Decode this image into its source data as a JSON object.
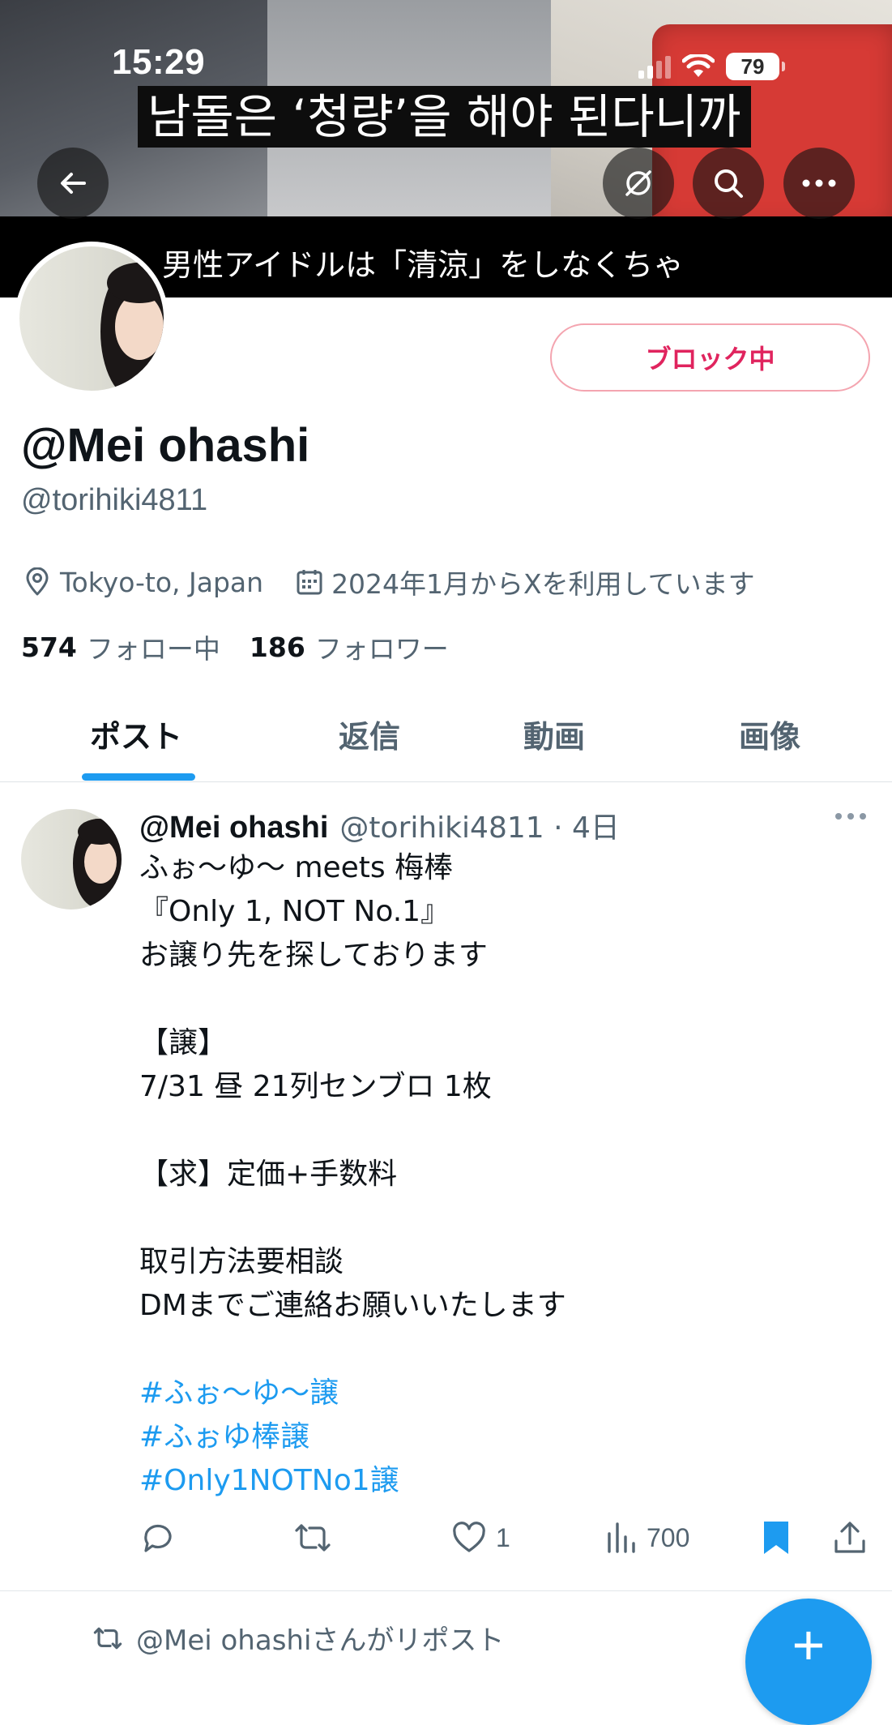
{
  "status_bar": {
    "time": "15:29",
    "battery": "79"
  },
  "banner": {
    "subtitle_korean": "남돌은 ‘청량’을 해야 된다니까",
    "subtitle_japanese": "男性アイドルは「清涼」をしなくちゃ"
  },
  "profile": {
    "block_button_label": "ブロック中",
    "display_name": "@Mei ohashi",
    "handle": "@torihiki4811",
    "location": "Tokyo-to, Japan",
    "joined": "2024年1月からXを利用しています",
    "following_count": "574",
    "following_label": "フォロー中",
    "followers_count": "186",
    "followers_label": "フォロワー"
  },
  "tabs": [
    {
      "label": "ポスト",
      "active": true
    },
    {
      "label": "返信",
      "active": false
    },
    {
      "label": "動画",
      "active": false
    },
    {
      "label": "画像",
      "active": false
    }
  ],
  "post": {
    "author_name": "@Mei ohashi",
    "author_handle": "@torihiki4811",
    "time": "4日",
    "lines": [
      "ふぉ〜ゆ〜 meets 梅棒",
      "『Only 1, NOT No.1』",
      "お譲り先を探しております",
      "",
      "【譲】",
      "7/31 昼 21列センブロ 1枚",
      "",
      "【求】定価+手数料",
      "",
      "取引方法要相談",
      "DMまでご連絡お願いいたします",
      ""
    ],
    "hashtags": [
      "#ふぉ〜ゆ〜譲",
      "#ふぉゆ棒譲",
      "#Only1NOTNo1譲"
    ],
    "like_count": "1",
    "view_count": "700",
    "accent_color": "#1d9bf0"
  },
  "next_item": {
    "repost_user": "@Mei ohashi",
    "repost_suffix": "さんがリポスト"
  },
  "fab": {
    "label": "+"
  }
}
